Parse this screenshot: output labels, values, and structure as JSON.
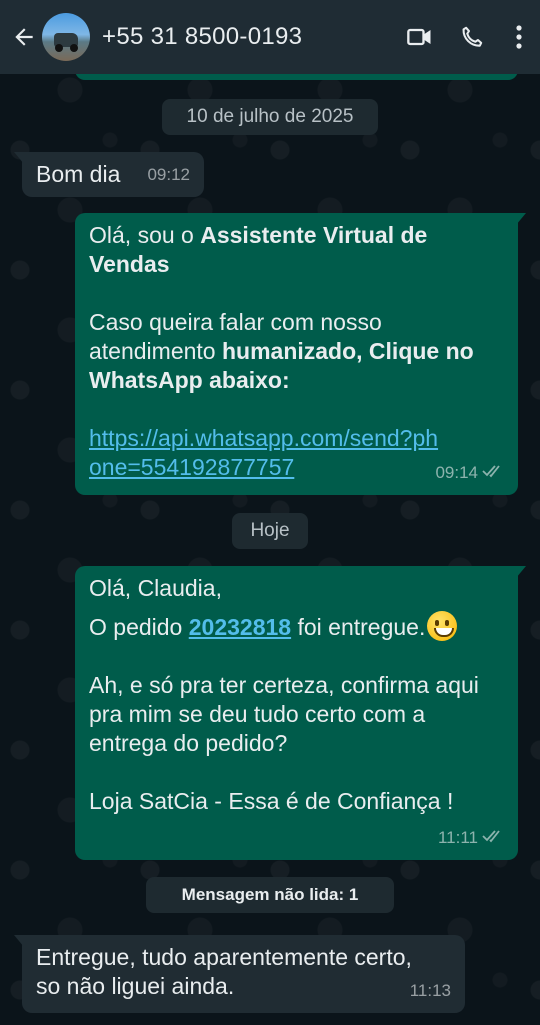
{
  "header": {
    "contact_name": "+55 31 8500-0193",
    "icons": [
      "back-arrow-icon",
      "avatar",
      "video-call-icon",
      "phone-icon",
      "more-vert-icon"
    ]
  },
  "messages": {
    "date1": "10 de julho de 2025",
    "msg1": {
      "text": "Bom dia",
      "time": "09:12"
    },
    "msg2": {
      "line1_plain": "Olá, sou o ",
      "line1_bold": "Assistente Virtual de Vendas",
      "line2_plain": "Caso queira falar com nosso atendimento ",
      "line2_bold": "humanizado, Clique no WhatsApp abaixo:",
      "link": "https://api.whatsapp.com/send?phone=554192877757",
      "time": "09:14"
    },
    "date2": "Hoje",
    "msg3": {
      "greeting": "Olá, Claudia,",
      "order_prefix": "O pedido ",
      "order_number": "20232818",
      "order_suffix": " foi entregue.",
      "question": "Ah, e só pra ter certeza, confirma aqui pra mim se deu tudo certo com a entrega do pedido?",
      "signature": "Loja SatCia - Essa é de Confiança !",
      "time": "11:11"
    },
    "unread_label": "Mensagem não lida: 1",
    "msg4": {
      "text": "Entregue, tudo aparentemente certo, so não liguei ainda.",
      "time": "11:13"
    }
  },
  "colors": {
    "background": "#0b141a",
    "header": "#1f2c34",
    "outgoing_bubble": "#005c4b",
    "incoming_bubble": "#202c33",
    "link": "#53bdeb"
  }
}
